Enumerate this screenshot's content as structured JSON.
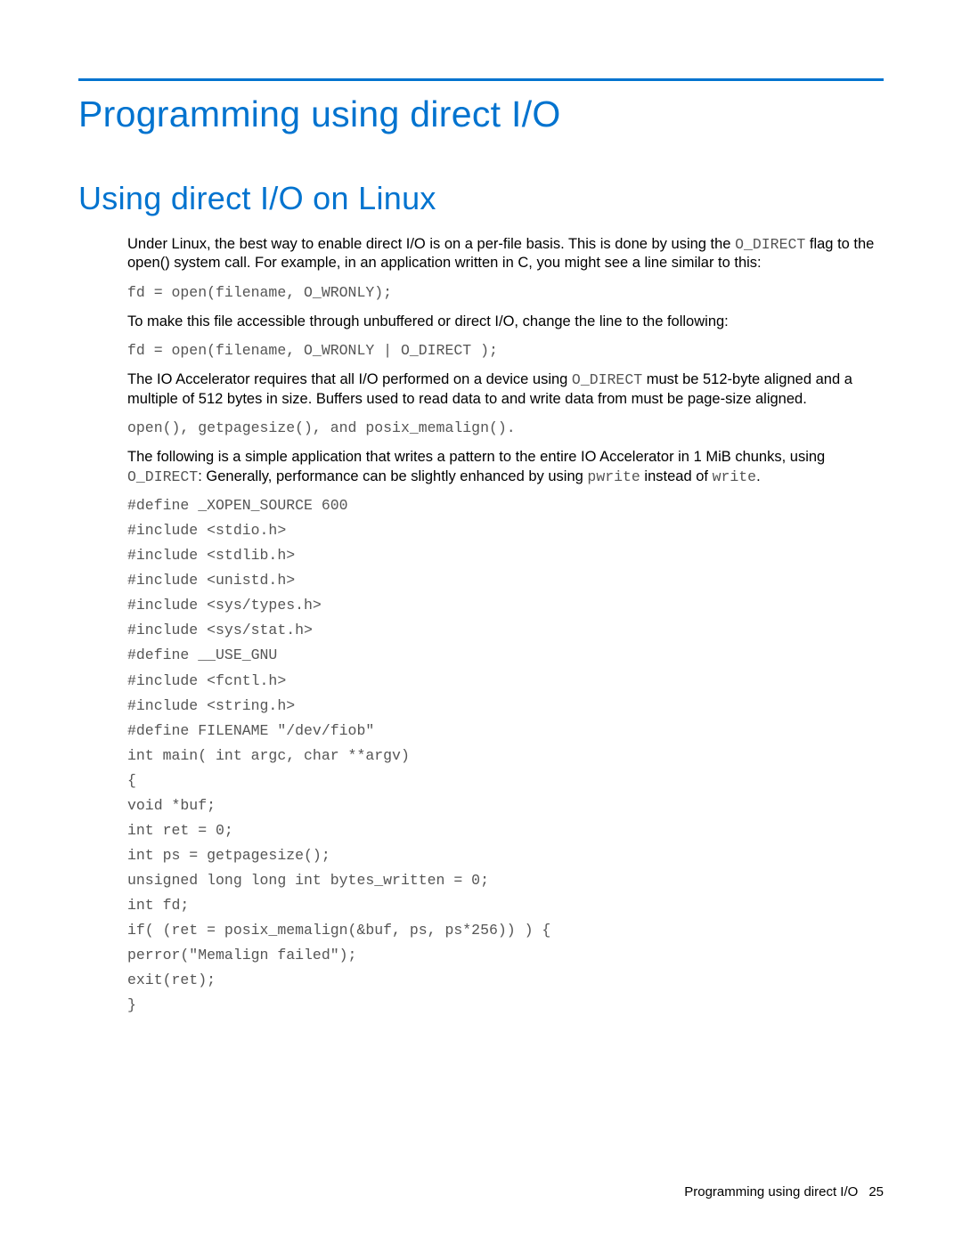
{
  "chapter_title": "Programming using direct I/O",
  "section_title": "Using direct I/O on Linux",
  "p1_a": "Under Linux, the best way to enable direct I/O is on a per-file basis. This is done by using the ",
  "p1_code": "O_DIRECT",
  "p1_b": " flag to the open() system call. For example, in an application written in C, you might see a line similar to this:",
  "code1": "fd = open(filename, O_WRONLY);",
  "p2": "To make this file accessible through unbuffered or direct I/O, change the line to the following:",
  "code2": "fd = open(filename, O_WRONLY | O_DIRECT );",
  "p3_a": "The IO Accelerator requires that all I/O performed on a device using ",
  "p3_code": "O_DIRECT",
  "p3_b": " must be 512-byte aligned and a multiple of 512 bytes in size. Buffers used to read data to and write data from must be page-size aligned.",
  "code3": "open(), getpagesize(), and posix_memalign().",
  "p4_a": "The following is a simple application that writes a pattern to the entire IO Accelerator in 1 MiB chunks, using ",
  "p4_code1": "O_DIRECT",
  "p4_b": ": Generally, performance can be slightly enhanced by using ",
  "p4_code2": "pwrite",
  "p4_c": " instead of ",
  "p4_code3": "write",
  "p4_d": ".",
  "code4": "#define _XOPEN_SOURCE 600\n#include <stdio.h>\n#include <stdlib.h>\n#include <unistd.h>\n#include <sys/types.h>\n#include <sys/stat.h>\n#define __USE_GNU\n#include <fcntl.h>\n#include <string.h>\n#define FILENAME \"/dev/fiob\"\nint main( int argc, char **argv)\n{\nvoid *buf;\nint ret = 0;\nint ps = getpagesize();\nunsigned long long int bytes_written = 0;\nint fd;\nif( (ret = posix_memalign(&buf, ps, ps*256)) ) {\nperror(\"Memalign failed\");\nexit(ret);\n}",
  "footer_text": "Programming using direct I/O",
  "footer_page": "25"
}
